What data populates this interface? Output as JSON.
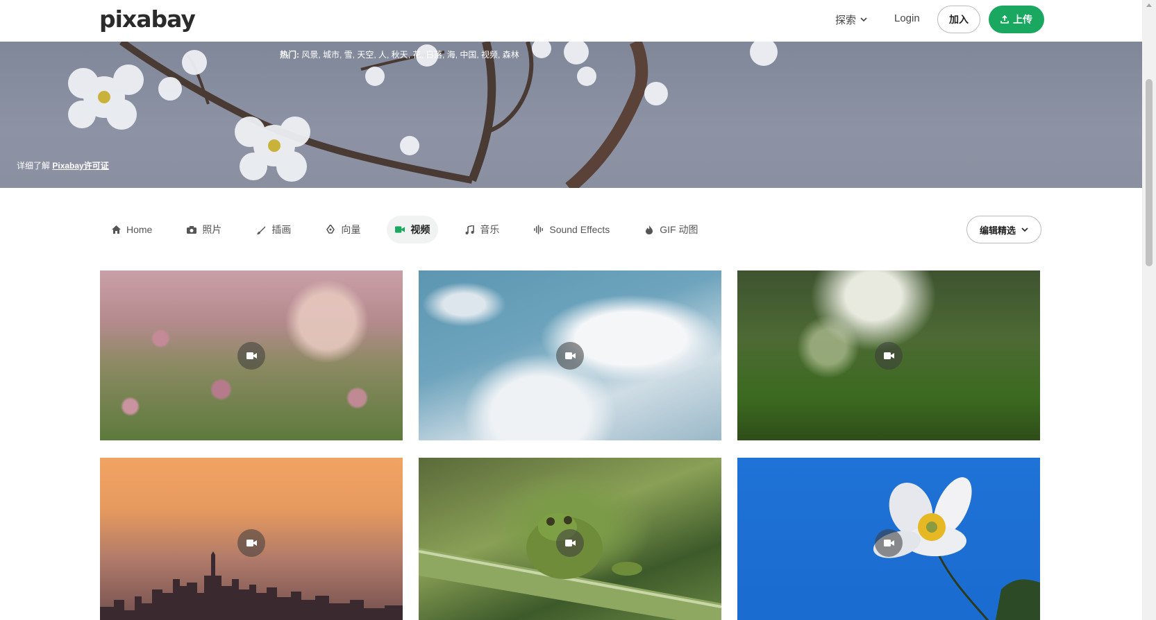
{
  "header": {
    "logo": "pixabay",
    "explore": "探索",
    "login": "Login",
    "join": "加入",
    "upload": "上传"
  },
  "hero": {
    "hot_label": "热门:",
    "hot_terms": "风景, 城市, 雪, 天空, 人, 秋天, 花, 日落, 海, 中国, 视频, 森林",
    "license_prefix": "详细了解",
    "license_link": "Pixabay许可证"
  },
  "tabs": [
    {
      "label": "Home",
      "icon": "home-icon"
    },
    {
      "label": "照片",
      "icon": "camera-icon"
    },
    {
      "label": "插画",
      "icon": "brush-icon"
    },
    {
      "label": "向量",
      "icon": "pen-tool-icon"
    },
    {
      "label": "视频",
      "icon": "video-icon",
      "active": true
    },
    {
      "label": "音乐",
      "icon": "music-note-icon"
    },
    {
      "label": "Sound Effects",
      "icon": "waveform-icon"
    },
    {
      "label": "GIF 动图",
      "icon": "flame-icon"
    }
  ],
  "sort": {
    "label": "编辑精选"
  },
  "accent_color": "#1aa861"
}
